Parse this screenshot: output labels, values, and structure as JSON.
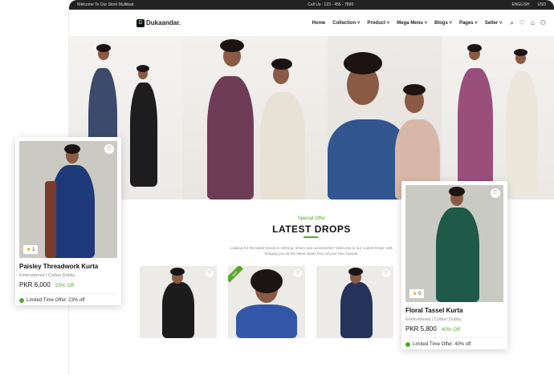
{
  "topbar": {
    "welcome": "Welcome To Our Store Multikart",
    "call": "Call Us : 123 - 456 - 7890",
    "language": "ENGLISH",
    "currency": "USD"
  },
  "brand": {
    "name": "Dukaandar.",
    "logo_letter": "D"
  },
  "nav": {
    "items": [
      "Home",
      "Collection ˅",
      "Product ˅",
      "Mega Menu ˅",
      "Blogs ˅",
      "Pages ˅",
      "Seller ˅"
    ]
  },
  "icons": {
    "search": "⌕",
    "wishlist": "♡",
    "cart": "⌂",
    "user": "⚇",
    "heart": "♡"
  },
  "section": {
    "subtitle": "Special Offer",
    "title": "LATEST DROPS",
    "description": "Looking for the latest trends in clothing, shoes and accessories? Welcome to our 'Latest Drops' edit, bringing you all the latest styles from all your fave brands."
  },
  "tiles": [
    {
      "badge": ""
    },
    {
      "badge": "Sale"
    },
    {
      "badge": ""
    }
  ],
  "cards": [
    {
      "name": "Paisley Threadwork Kurta",
      "meta": "Embroidered | Cotton Dobby",
      "price": "PKR 6,000",
      "discount": "23% Off",
      "offer": "Limited Time Offer: 23% off",
      "rating": "1",
      "star": "★"
    },
    {
      "name": "Floral Tassel Kurta",
      "meta": "Embroidered | Cotton Dobby",
      "price": "PKR 5,800",
      "discount": "40% Off",
      "offer": "Limited Time Offer: 40% off",
      "rating": "0",
      "star": "★"
    }
  ],
  "colors": {
    "accent": "#57a82a",
    "topbar": "#222222"
  }
}
